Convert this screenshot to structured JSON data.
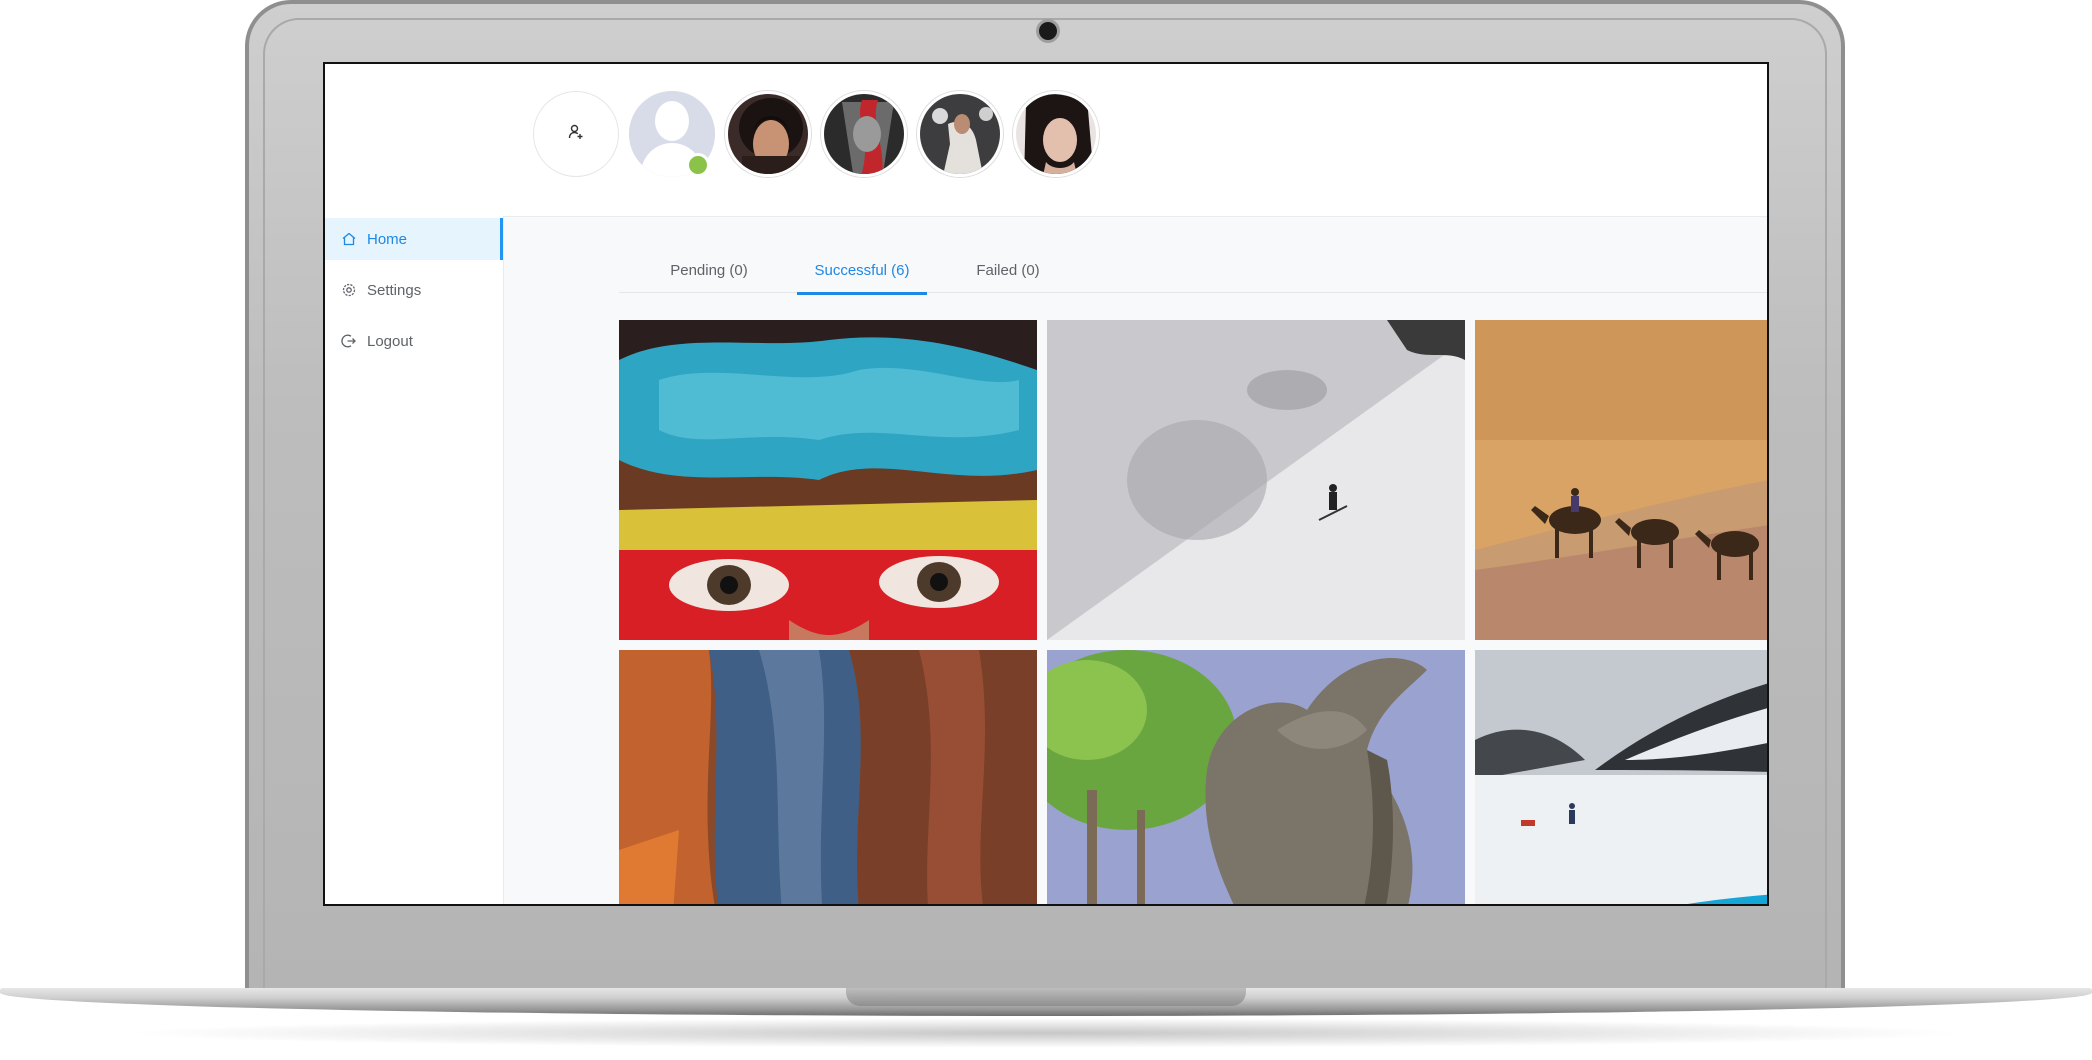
{
  "sidebar": {
    "items": [
      {
        "label": "Home",
        "icon": "home-icon",
        "active": true
      },
      {
        "label": "Settings",
        "icon": "gear-icon",
        "active": false
      },
      {
        "label": "Logout",
        "icon": "logout-icon",
        "active": false
      }
    ]
  },
  "stories": {
    "add_icon": "add-user-icon",
    "online_status_color": "#8bc34a",
    "count_photos": 4
  },
  "tabs": [
    {
      "label": "Pending (0)",
      "active": false
    },
    {
      "label": "Successful (6)",
      "active": true
    },
    {
      "label": "Failed (0)",
      "active": false
    }
  ],
  "gallery": {
    "images": [
      "face-paint-photo",
      "snow-skier-photo",
      "camel-caravan-photo",
      "canyon-rocks-photo",
      "elephant-photo",
      "glacier-lake-photo"
    ]
  },
  "colors": {
    "accent": "#1e88e5",
    "active_bg": "#e6f4fd"
  }
}
